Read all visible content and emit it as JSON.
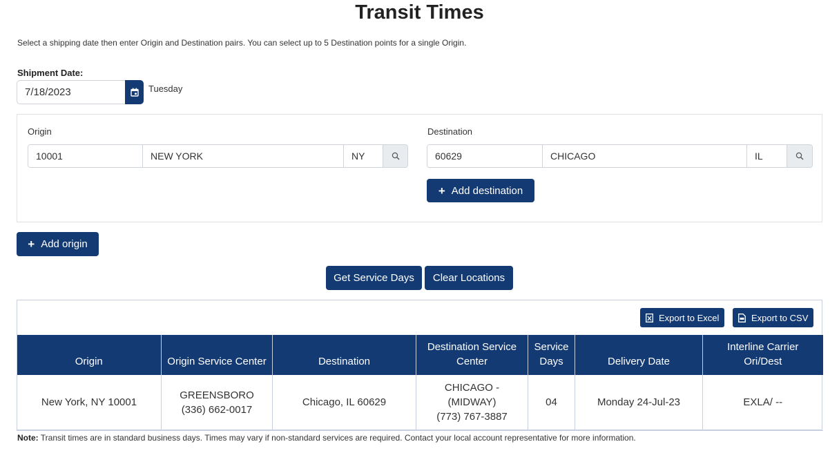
{
  "page": {
    "title": "Transit Times",
    "intro": "Select a shipping date then enter Origin and Destination pairs. You can select up to 5 Destination points for a single Origin."
  },
  "shipment": {
    "label": "Shipment Date:",
    "date": "7/18/2023",
    "weekday": "Tuesday",
    "calendar_icon": "calendar-icon"
  },
  "origin": {
    "label": "Origin",
    "zip": "10001",
    "city": "NEW YORK",
    "state": "NY",
    "search_icon": "search-icon"
  },
  "destination": {
    "label": "Destination",
    "zip": "60629",
    "city": "CHICAGO",
    "state": "IL",
    "search_icon": "search-icon"
  },
  "buttons": {
    "add_destination": "Add destination",
    "add_origin": "Add origin",
    "get_service_days": "Get Service Days",
    "clear_locations": "Clear Locations",
    "export_excel": "Export to Excel",
    "export_csv": "Export to CSV"
  },
  "table": {
    "headers": [
      "Origin",
      "Origin Service Center",
      "Destination",
      "Destination Service Center",
      "Service Days",
      "Delivery Date",
      "Interline Carrier Ori/Dest"
    ],
    "rows": [
      {
        "origin": "New York, NY 10001",
        "origin_sc_name": "GREENSBORO",
        "origin_sc_phone": "(336) 662-0017",
        "destination": "Chicago, IL 60629",
        "dest_sc_name_1": "CHICAGO -",
        "dest_sc_name_2": "(MIDWAY)",
        "dest_sc_phone": "(773) 767-3887",
        "service_days": "04",
        "delivery_date": "Monday 24-Jul-23",
        "interline": "EXLA/ --"
      }
    ]
  },
  "note": {
    "label": "Note:",
    "text": " Transit times are in standard business days. Times may vary if non-standard services are required. Contact your local account representative for more information."
  },
  "colors": {
    "primary": "#133a73",
    "border": "#c7cfe0"
  }
}
